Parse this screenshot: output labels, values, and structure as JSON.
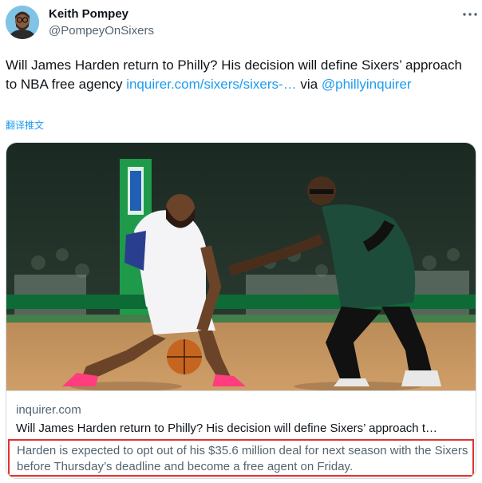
{
  "author": {
    "display_name": "Keith Pompey",
    "handle": "@PompeyOnSixers",
    "avatar_icon": "avatar-illustration-icon"
  },
  "menu": {
    "icon": "more-horizontal-icon"
  },
  "tweet": {
    "text_part1": "Will James Harden return to Philly? His decision will define Sixers’ approach to NBA free agency ",
    "link_text": "inquirer.com/sixers/sixers-…",
    "text_part2": " via ",
    "mention": "@phillyinquirer",
    "translate_label": "翻译推文"
  },
  "card": {
    "image_icon": "basketball-photo",
    "domain": "inquirer.com",
    "title": "Will James Harden return to Philly? His decision will define Sixers’ approach t…",
    "description": "Harden is expected to opt out of his $35.6 million deal for next season with the Sixers before Thursday’s deadline and become a free agent on Friday.",
    "highlight_color": "#e0332f"
  },
  "colors": {
    "link": "#1d9bf0",
    "text": "#0f1419",
    "secondary": "#536471",
    "border": "#cfd9de"
  }
}
